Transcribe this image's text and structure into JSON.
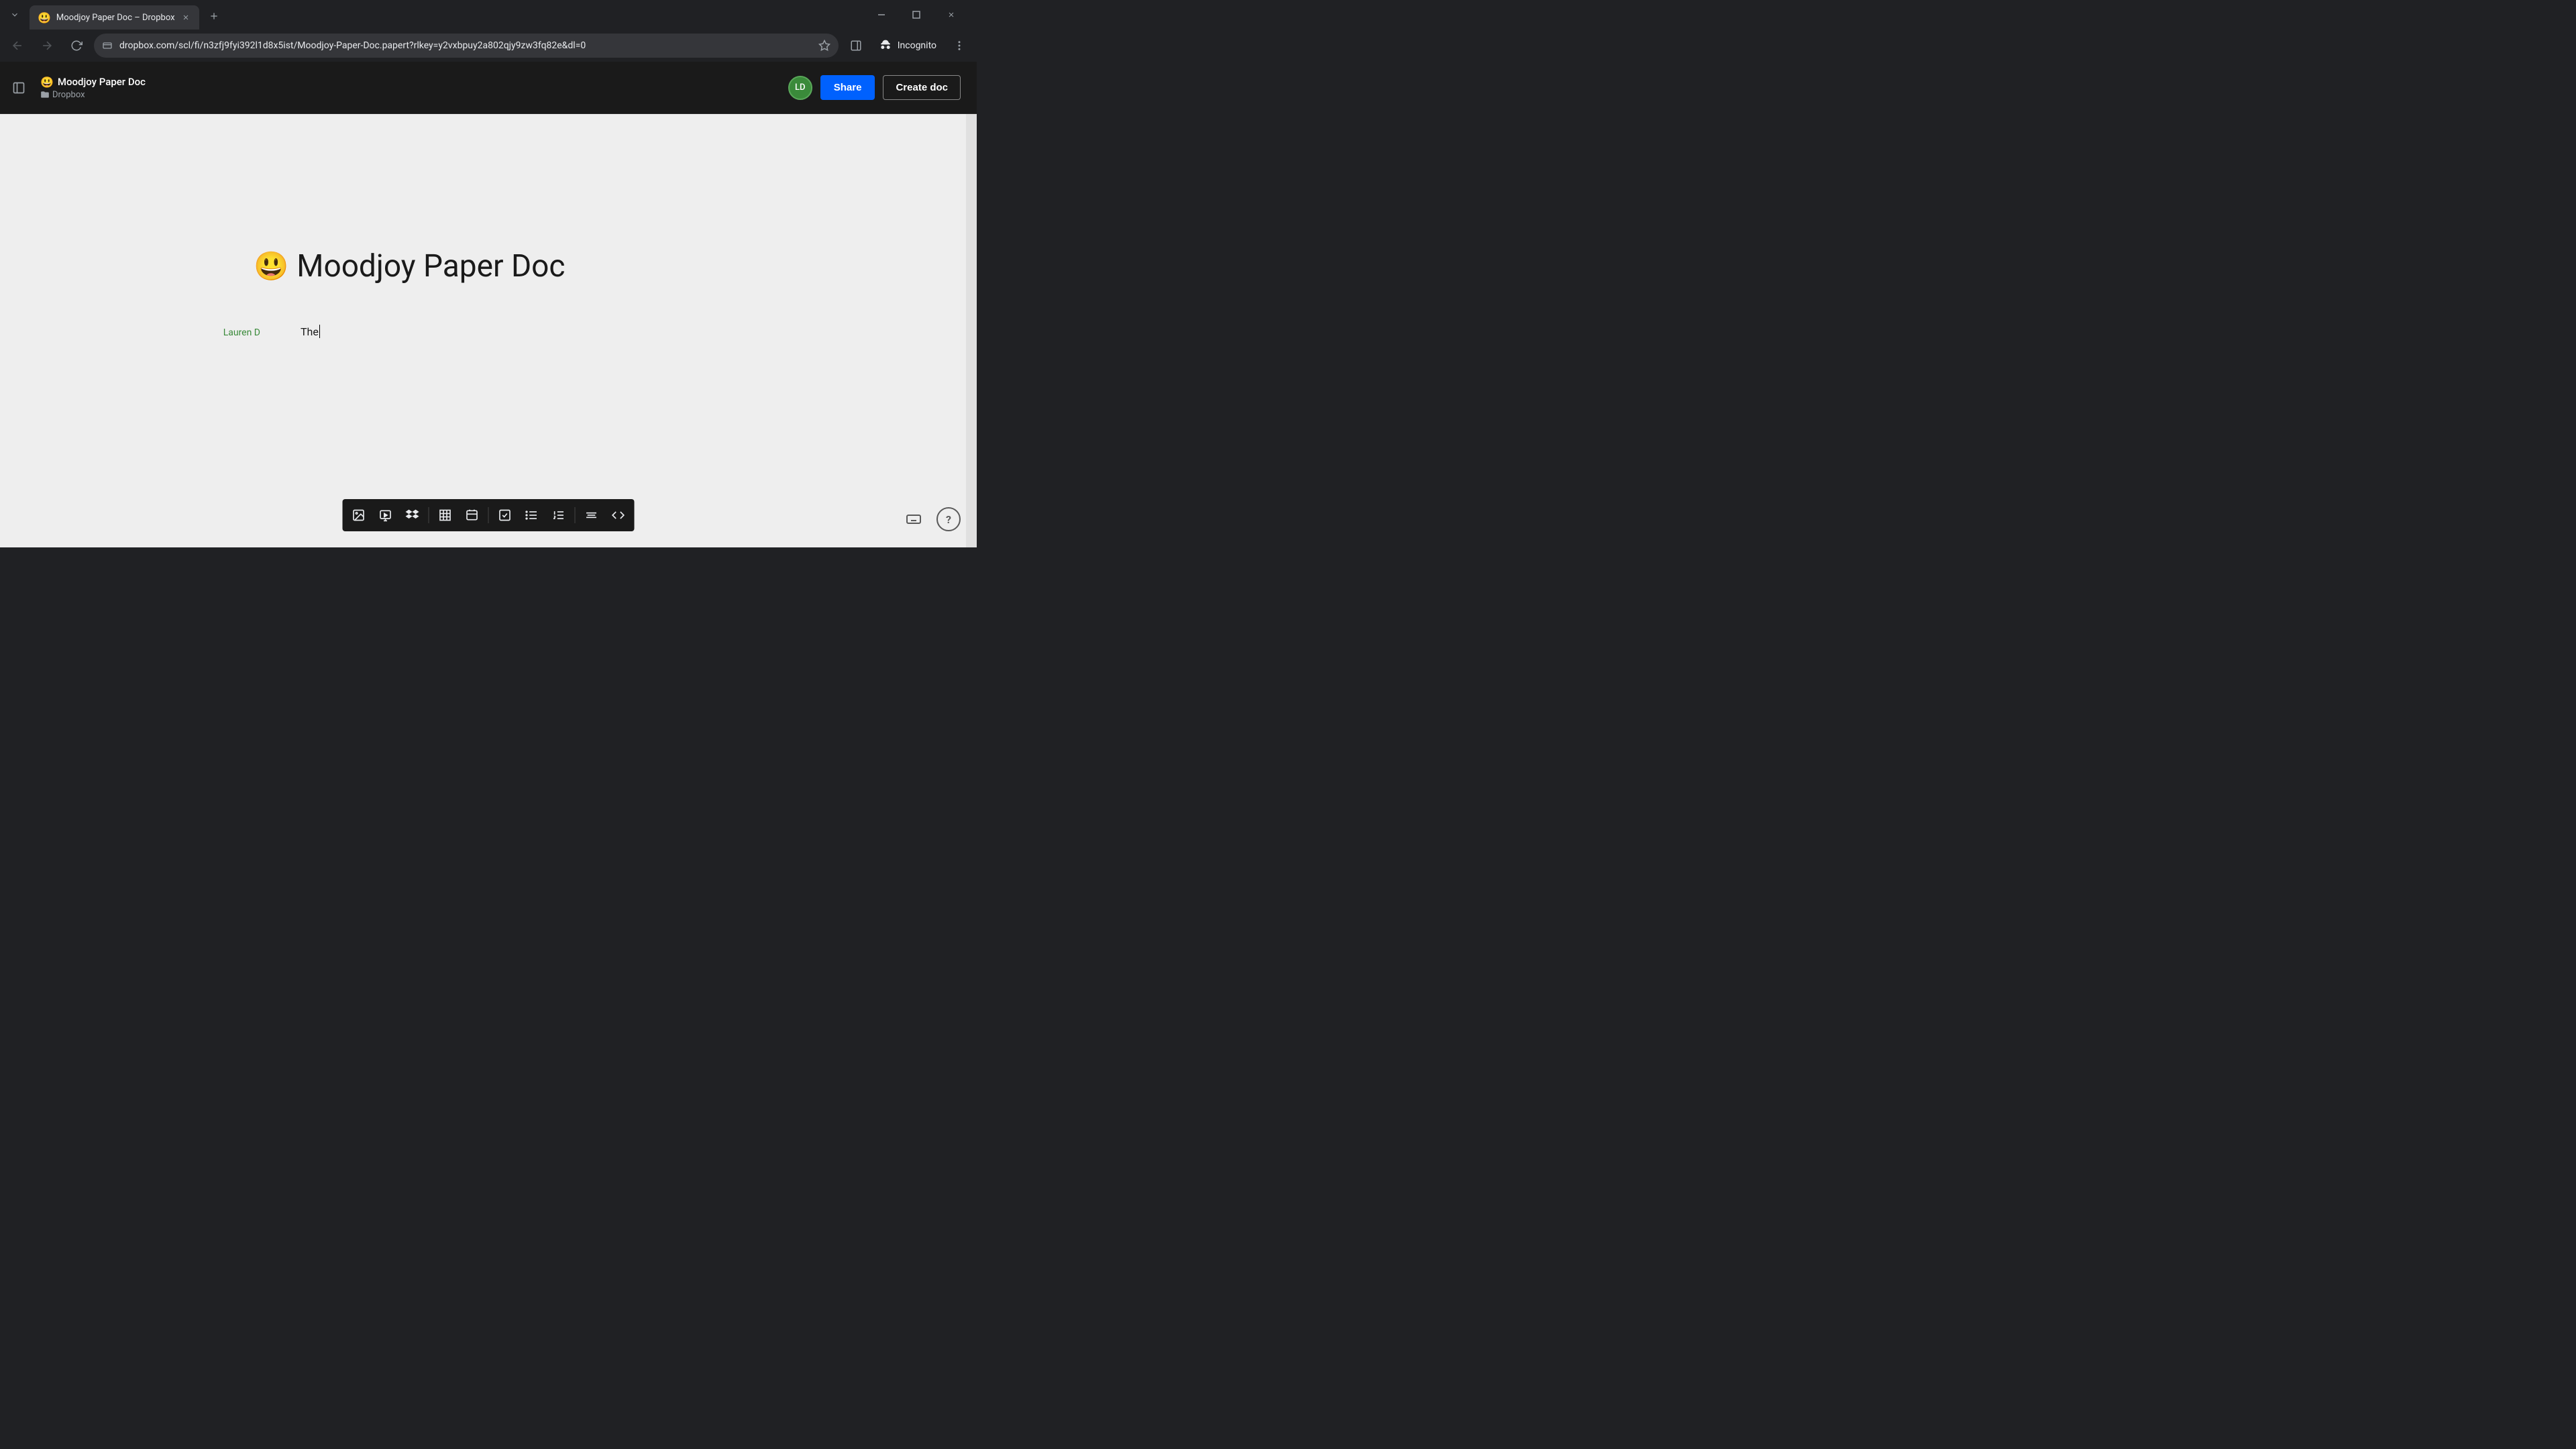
{
  "browser": {
    "tab_title": "Moodjoy Paper Doc – Dropbox",
    "url": "dropbox.com/scl/fi/n3zfj9fyi392l1d8x5ist/Moodjoy-Paper-Doc.papert?rlkey=y2vxbpuy2a802qjy9zw3fq82e&dl=0",
    "incognito_label": "Incognito"
  },
  "header": {
    "doc_title": "Moodjoy Paper Doc",
    "breadcrumb_root": "Dropbox",
    "avatar_initials": "LD",
    "share_label": "Share",
    "create_doc_label": "Create doc"
  },
  "document": {
    "heading_emoji": "😃",
    "heading_text": "Moodjoy Paper Doc",
    "author_label": "Lauren D",
    "body_text": "The"
  },
  "toolbar": {
    "items": [
      {
        "name": "image-icon"
      },
      {
        "name": "video-icon"
      },
      {
        "name": "dropbox-icon"
      },
      {
        "name": "table-icon"
      },
      {
        "name": "timeline-icon"
      },
      {
        "name": "checkbox-icon"
      },
      {
        "name": "bullet-list-icon"
      },
      {
        "name": "numbered-list-icon"
      },
      {
        "name": "divider-icon"
      },
      {
        "name": "code-icon"
      }
    ]
  },
  "help": {
    "keyboard_label": "Keyboard shortcuts",
    "help_label": "?"
  }
}
